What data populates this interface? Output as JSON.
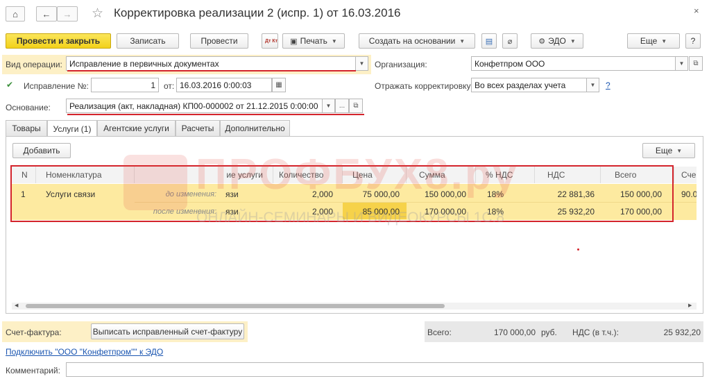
{
  "window": {
    "title": "Корректировка реализации 2 (испр. 1) от 16.03.2016",
    "home_icon": "⌂",
    "back_icon": "←",
    "forward_icon": "→",
    "star_icon": "☆",
    "close_icon": "×"
  },
  "toolbar": {
    "post_and_close": "Провести и закрыть",
    "save": "Записать",
    "post": "Провести",
    "dtkt_icon": "Дт Кт",
    "print": "Печать",
    "create_based_on": "Создать на основании",
    "doc_icon": "▤",
    "attach_icon": "⊘",
    "edo": "ЭДО",
    "more": "Еще",
    "help": "?"
  },
  "form": {
    "operation_label": "Вид операции:",
    "operation_value": "Исправление в первичных документах",
    "organization_label": "Организация:",
    "organization_value": "Конфетпром ООО",
    "correction_label": "Исправление №:",
    "correction_number": "1",
    "from_label": "от:",
    "date_value": "16.03.2016  0:00:03",
    "reflect_label": "Отражать корректировку:",
    "reflect_value": "Во всех разделах учета",
    "help_link": "?",
    "basis_label": "Основание:",
    "basis_value": "Реализация (акт, накладная) КП00-000002 от 21.12.2015 0:00:00",
    "dots": "..."
  },
  "tabs": [
    {
      "label": "Товары"
    },
    {
      "label": "Услуги (1)"
    },
    {
      "label": "Агентские услуги"
    },
    {
      "label": "Расчеты"
    },
    {
      "label": "Дополнительно"
    }
  ],
  "table_toolbar": {
    "add": "Добавить",
    "more": "Еще"
  },
  "table": {
    "headers": [
      "N",
      "Номенклатура",
      "ие услуги",
      "Количество",
      "Цена",
      "Сумма",
      "% НДС",
      "НДС",
      "Всего",
      "Сче"
    ],
    "row": {
      "n": "1",
      "name": "Услуги связи",
      "before_label": "до изменения:",
      "after_label": "после изменения:",
      "before": {
        "service": "язи",
        "qty": "2,000",
        "price": "75 000,00",
        "sum": "150 000,00",
        "vat_rate": "18%",
        "vat": "22 881,36",
        "total": "150 000,00",
        "acc": "90.0"
      },
      "after": {
        "service": "язи",
        "qty": "2,000",
        "price": "85 000,00",
        "sum": "170 000,00",
        "vat_rate": "18%",
        "vat": "25 932,20",
        "total": "170 000,00"
      }
    }
  },
  "watermark": {
    "main": "ПРОФБУХ8.ру",
    "sub": "ОНЛАЙН-СЕМИНАРЫ И ВИДЕОКУРСЫ 1С:8"
  },
  "footer": {
    "invoice_label": "Счет-фактура:",
    "invoice_button": "Выписать исправленный счет-фактуру",
    "total_label": "Всего:",
    "total_value": "170 000,00",
    "currency": "руб.",
    "vat_label": "НДС (в т.ч.):",
    "vat_value": "25 932,20",
    "edo_link": "Подключить \"ООО \"Конфетпром\"\" к ЭДО",
    "comment_label": "Комментарий:"
  }
}
